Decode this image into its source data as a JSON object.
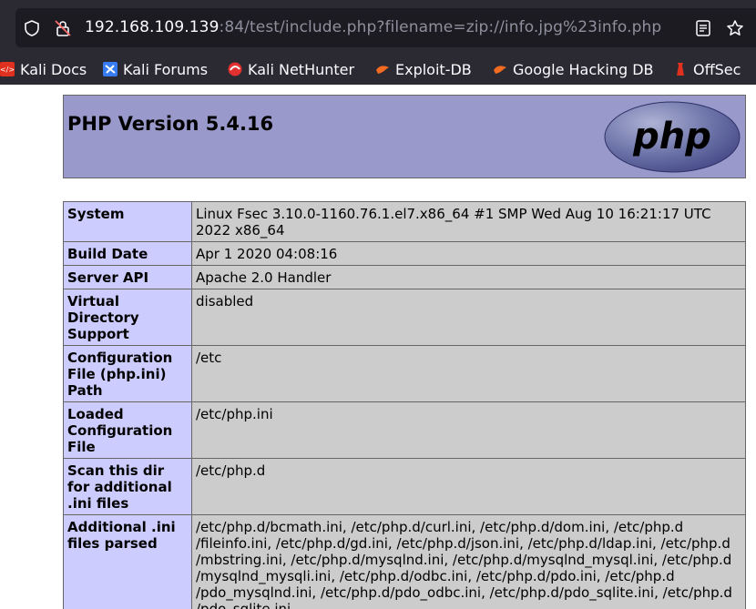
{
  "browser": {
    "url_host": "192.168.109.139",
    "url_rest": ":84/test/include.php?filename=zip://info.jpg%23info.php",
    "bookmarks": [
      {
        "label": "Kali Docs",
        "icon": "kali-docs-icon"
      },
      {
        "label": "Kali Forums",
        "icon": "kali-forums-icon"
      },
      {
        "label": "Kali NetHunter",
        "icon": "kali-nethunter-icon"
      },
      {
        "label": "Exploit-DB",
        "icon": "exploit-db-icon"
      },
      {
        "label": "Google Hacking DB",
        "icon": "google-hacking-db-icon"
      },
      {
        "label": "OffSec",
        "icon": "offsec-icon"
      }
    ]
  },
  "page": {
    "title": "PHP Version 5.4.16",
    "logo_text": "php",
    "colors": {
      "header_bg": "#9999cc",
      "key_bg": "#ccccff",
      "value_bg": "#cccccc"
    },
    "rows": [
      {
        "key": "System",
        "value": "Linux Fsec 3.10.0-1160.76.1.el7.x86_64 #1 SMP Wed Aug 10 16:21:17 UTC 2022 x86_64"
      },
      {
        "key": "Build Date",
        "value": "Apr 1 2020 04:08:16"
      },
      {
        "key": "Server API",
        "value": "Apache 2.0 Handler"
      },
      {
        "key": "Virtual Directory Support",
        "value": "disabled"
      },
      {
        "key": "Configuration File (php.ini) Path",
        "value": "/etc"
      },
      {
        "key": "Loaded Configuration File",
        "value": "/etc/php.ini"
      },
      {
        "key": "Scan this dir for additional .ini files",
        "value": "/etc/php.d"
      },
      {
        "key": "Additional .ini files parsed",
        "value": "/etc/php.d/bcmath.ini, /etc/php.d/curl.ini, /etc/php.d/dom.ini, /etc/php.d /fileinfo.ini, /etc/php.d/gd.ini, /etc/php.d/json.ini, /etc/php.d/ldap.ini, /etc/php.d /mbstring.ini, /etc/php.d/mysqlnd.ini, /etc/php.d/mysqlnd_mysql.ini, /etc/php.d /mysqlnd_mysqli.ini, /etc/php.d/odbc.ini, /etc/php.d/pdo.ini, /etc/php.d /pdo_mysqlnd.ini, /etc/php.d/pdo_odbc.ini, /etc/php.d/pdo_sqlite.ini, /etc/php.d /pdo_sqlite.ini"
      }
    ]
  }
}
